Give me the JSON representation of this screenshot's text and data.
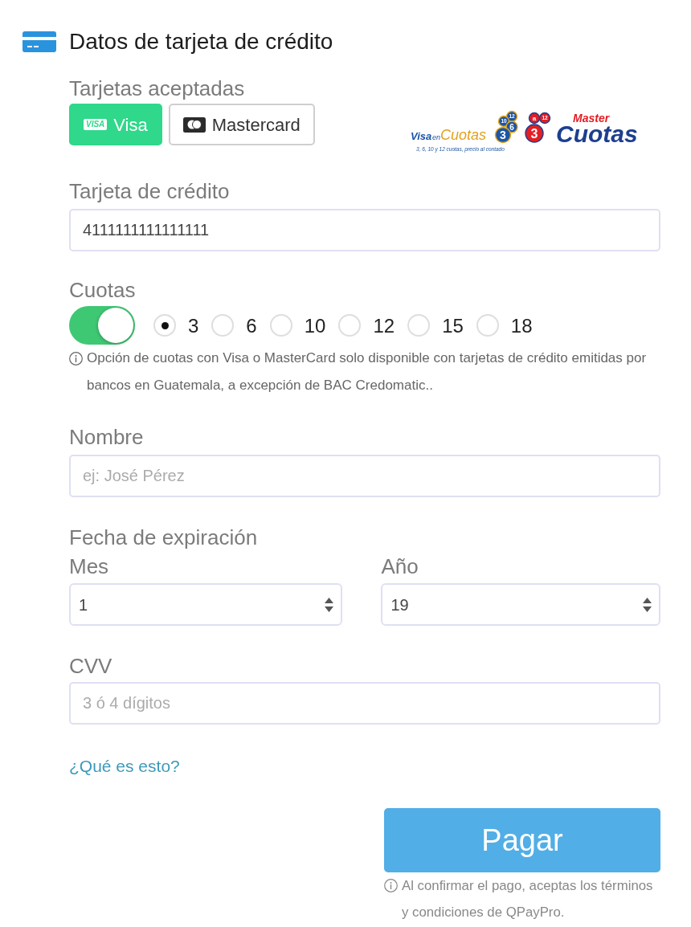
{
  "header": {
    "title": "Datos de tarjeta de crédito"
  },
  "accepted_cards": {
    "label": "Tarjetas aceptadas",
    "options": [
      {
        "kind": "visa",
        "logo_text": "VISA",
        "label": "Visa",
        "selected": true
      },
      {
        "kind": "mastercard",
        "label": "Mastercard",
        "selected": false
      }
    ]
  },
  "promo_logos": [
    {
      "kind": "visa_cuotas",
      "words": [
        "Visa",
        "en",
        "Cuotas"
      ],
      "badges": [
        "12",
        "10",
        "6",
        "3"
      ],
      "tagline": "3, 6, 10 y 12 cuotas, precio al contado"
    },
    {
      "kind": "master_cuotas",
      "words": [
        "Master",
        "Cuotas"
      ],
      "badges": [
        "a",
        "12",
        "3"
      ]
    }
  ],
  "card_number": {
    "label": "Tarjeta de crédito",
    "value": "4111111111111111"
  },
  "installments": {
    "label": "Cuotas",
    "on": true,
    "options": [
      {
        "label": "3",
        "selected": true
      },
      {
        "label": "6",
        "selected": false
      },
      {
        "label": "10",
        "selected": false
      },
      {
        "label": "12",
        "selected": false
      },
      {
        "label": "15",
        "selected": false
      },
      {
        "label": "18",
        "selected": false
      }
    ],
    "note": "Opción de cuotas con Visa o MasterCard solo disponible con tarjetas de crédito emitidas por bancos en Guatemala, a excepción de BAC Credomatic.."
  },
  "name": {
    "label": "Nombre",
    "placeholder": "ej: José Pérez"
  },
  "expiration": {
    "label": "Fecha de expiración",
    "fields": [
      {
        "label": "Mes",
        "value": "1"
      },
      {
        "label": "Año",
        "value": "19"
      }
    ]
  },
  "cvv": {
    "label": "CVV",
    "placeholder": "3 ó 4 dígitos"
  },
  "help_link": {
    "label": "¿Qué es esto?"
  },
  "pay_button": {
    "label": "Pagar"
  },
  "terms_note": "Al confirmar el pago, aceptas los términos y condiciones de QPayPro."
}
